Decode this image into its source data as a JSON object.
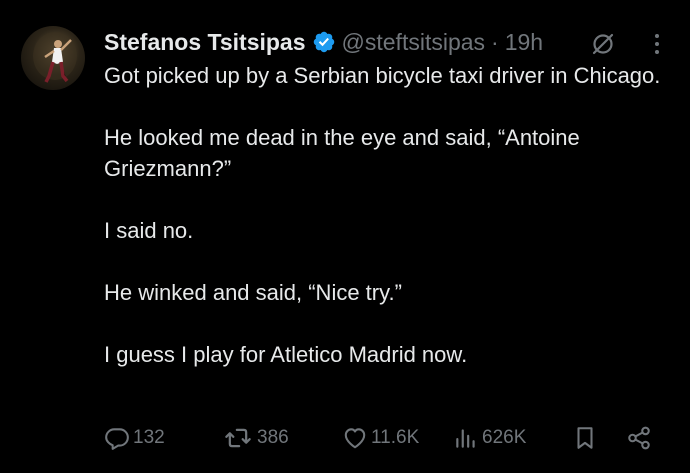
{
  "tweet": {
    "author_name": "Stefanos Tsitsipas",
    "handle": "@steftsitsipas",
    "separator": "·",
    "time": "19h",
    "paragraphs": [
      "Got picked up by a Serbian bicycle taxi driver in Chicago.",
      "He looked me dead in the eye and said, “Antoine Griezmann?”",
      "I said no.",
      "He winked and said, “Nice try.”",
      "I guess I play for Atletico Madrid now."
    ],
    "stats": {
      "replies": "132",
      "reposts": "386",
      "likes": "11.6K",
      "views": "626K"
    }
  },
  "colors": {
    "background": "#000000",
    "text": "#e7e9ea",
    "muted": "#71767b",
    "verified": "#1d9bf0"
  },
  "icons": [
    "verified-badge-icon",
    "grok-icon",
    "more-options-icon",
    "reply-icon",
    "repost-icon",
    "like-icon",
    "views-icon",
    "bookmark-icon",
    "share-icon"
  ]
}
